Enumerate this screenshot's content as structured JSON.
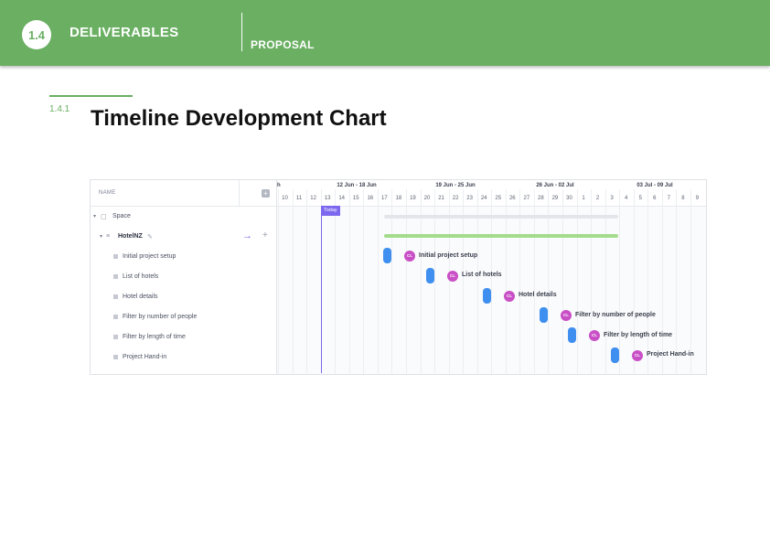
{
  "header": {
    "section_number": "1.4",
    "section_title": "DELIVERABLES",
    "subsection": "PROPOSAL"
  },
  "subheading": {
    "number": "1.4.1",
    "title": "Timeline Development Chart"
  },
  "gantt": {
    "name_column_label": "NAME",
    "add_column_symbol": "+",
    "today_label": "Today",
    "weeks": [
      "12 Jun - 18 Jun",
      "19 Jun - 25 Jun",
      "26 Jun - 02 Jul",
      "03 Jul - 09 Jul"
    ],
    "partial_week_label": "h",
    "days": [
      "10",
      "11",
      "12",
      "13",
      "14",
      "15",
      "16",
      "17",
      "18",
      "19",
      "20",
      "21",
      "22",
      "23",
      "24",
      "25",
      "26",
      "27",
      "28",
      "29",
      "30",
      "1",
      "2",
      "3",
      "4",
      "5",
      "6",
      "7",
      "8",
      "9"
    ],
    "space": {
      "label": "Space"
    },
    "list": {
      "label": "HotelNZ"
    },
    "tasks": [
      {
        "label": "Initial project setup",
        "avatar": "CL"
      },
      {
        "label": "List of hotels",
        "avatar": "CL"
      },
      {
        "label": "Hotel details",
        "avatar": "CL"
      },
      {
        "label": "Filter by number of people",
        "avatar": "CL"
      },
      {
        "label": "Filter by length of time",
        "avatar": "CL"
      },
      {
        "label": "Project Hand-in",
        "avatar": "CL"
      }
    ],
    "colors": {
      "today": "#7b68ee",
      "milestone": "#3f8ff0",
      "avatar": "#c94fc6",
      "list_bar": "#a3dc8b",
      "space_bar": "#e3e5ea"
    }
  }
}
